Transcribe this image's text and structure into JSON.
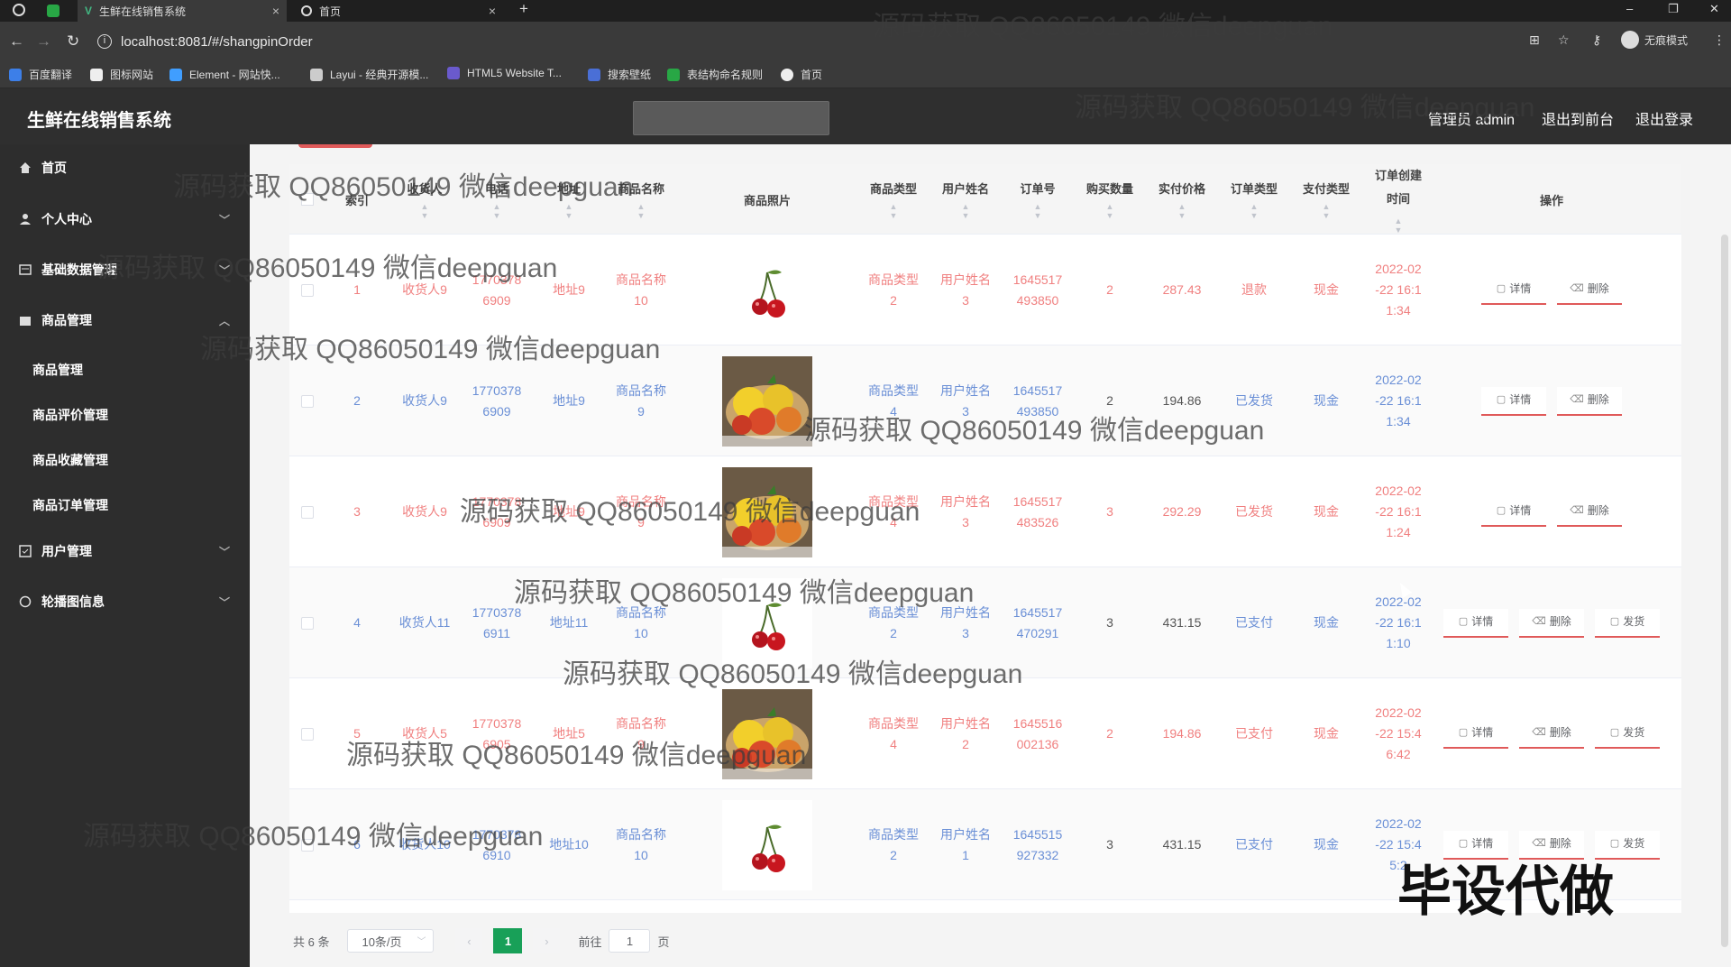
{
  "browser": {
    "tabs": [
      {
        "label": "生鲜在线销售系统",
        "active": true
      },
      {
        "label": "首页",
        "active": false
      }
    ],
    "new_tab": "+",
    "url": "localhost:8081/#/shangpinOrder",
    "profile": "无痕模式",
    "bookmarks": [
      "百度翻译",
      "图标网站",
      "Element - 网站快...",
      "Layui - 经典开源模...",
      "HTML5 Website T...",
      "搜索壁纸",
      "表结构命名规则",
      "首页"
    ]
  },
  "header": {
    "title": "生鲜在线销售系统",
    "admin": "管理员 admin",
    "front": "退出到前台",
    "logout": "退出登录"
  },
  "sidebar": {
    "items": [
      {
        "label": "首页",
        "icon": "home-icon"
      },
      {
        "label": "个人中心",
        "icon": "user-icon"
      },
      {
        "label": "基础数据管理",
        "icon": "data-icon"
      },
      {
        "label": "商品管理",
        "icon": "goods-icon"
      },
      {
        "label": "用户管理",
        "icon": "users-icon"
      },
      {
        "label": "轮播图信息",
        "icon": "carousel-icon"
      }
    ],
    "sub": [
      "商品管理",
      "商品评价管理",
      "商品收藏管理",
      "商品订单管理"
    ]
  },
  "table": {
    "headers": [
      "索引",
      "收货人",
      "电话",
      "地址",
      "商品名称",
      "商品照片",
      "商品类型",
      "用户姓名",
      "订单号",
      "购买数量",
      "实付价格",
      "订单类型",
      "支付类型",
      "订单创建时间",
      "操作"
    ],
    "rows": [
      {
        "idx": "1",
        "receiver": "收货人9",
        "phone": [
          "1770378",
          "6909"
        ],
        "addr": "地址9",
        "name": [
          "商品名称",
          "10"
        ],
        "photo": "cherry",
        "type": [
          "商品类型",
          "2"
        ],
        "user": [
          "用户姓名",
          "3"
        ],
        "order": [
          "1645517",
          "493850"
        ],
        "qty": "2",
        "price": "287.43",
        "otype": "退款",
        "pay": "现金",
        "time": [
          "2022-02",
          "-22 16:1",
          "1:34"
        ],
        "ops": [
          "详情",
          "删除"
        ],
        "color": "red"
      },
      {
        "idx": "2",
        "receiver": "收货人9",
        "phone": [
          "1770378",
          "6909"
        ],
        "addr": "地址9",
        "name": [
          "商品名称",
          "9"
        ],
        "photo": "fruit",
        "type": [
          "商品类型",
          "4"
        ],
        "user": [
          "用户姓名",
          "3"
        ],
        "order": [
          "1645517",
          "493850"
        ],
        "qty": "2",
        "price": "194.86",
        "otype": "已发货",
        "pay": "现金",
        "time": [
          "2022-02",
          "-22 16:1",
          "1:34"
        ],
        "ops": [
          "详情",
          "删除"
        ],
        "color": "blue"
      },
      {
        "idx": "3",
        "receiver": "收货人9",
        "phone": [
          "1770378",
          "6909"
        ],
        "addr": "地址9",
        "name": [
          "商品名称",
          "9"
        ],
        "photo": "fruit",
        "type": [
          "商品类型",
          "4"
        ],
        "user": [
          "用户姓名",
          "3"
        ],
        "order": [
          "1645517",
          "483526"
        ],
        "qty": "3",
        "price": "292.29",
        "otype": "已发货",
        "pay": "现金",
        "time": [
          "2022-02",
          "-22 16:1",
          "1:24"
        ],
        "ops": [
          "详情",
          "删除"
        ],
        "color": "red"
      },
      {
        "idx": "4",
        "receiver": "收货人11",
        "phone": [
          "1770378",
          "6911"
        ],
        "addr": "地址11",
        "name": [
          "商品名称",
          "10"
        ],
        "photo": "cherry",
        "type": [
          "商品类型",
          "2"
        ],
        "user": [
          "用户姓名",
          "3"
        ],
        "order": [
          "1645517",
          "470291"
        ],
        "qty": "3",
        "price": "431.15",
        "otype": "已支付",
        "pay": "现金",
        "time": [
          "2022-02",
          "-22 16:1",
          "1:10"
        ],
        "ops": [
          "详情",
          "删除",
          "发货"
        ],
        "color": "blue"
      },
      {
        "idx": "5",
        "receiver": "收货人5",
        "phone": [
          "1770378",
          "6905"
        ],
        "addr": "地址5",
        "name": [
          "商品名称",
          "9"
        ],
        "photo": "fruit",
        "type": [
          "商品类型",
          "4"
        ],
        "user": [
          "用户姓名",
          "2"
        ],
        "order": [
          "1645516",
          "002136"
        ],
        "qty": "2",
        "price": "194.86",
        "otype": "已支付",
        "pay": "现金",
        "time": [
          "2022-02",
          "-22 15:4",
          "6:42"
        ],
        "ops": [
          "详情",
          "删除",
          "发货"
        ],
        "color": "red"
      },
      {
        "idx": "6",
        "receiver": "收货人10",
        "phone": [
          "1770378",
          "6910"
        ],
        "addr": "地址10",
        "name": [
          "商品名称",
          "10"
        ],
        "photo": "cherry",
        "type": [
          "商品类型",
          "2"
        ],
        "user": [
          "用户姓名",
          "1"
        ],
        "order": [
          "1645515",
          "927332"
        ],
        "qty": "3",
        "price": "431.15",
        "otype": "已支付",
        "pay": "现金",
        "time": [
          "2022-02",
          "-22 15:4",
          "5:2"
        ],
        "ops": [
          "详情",
          "删除",
          "发货"
        ],
        "color": "blue"
      }
    ]
  },
  "pager": {
    "total": "共 6 条",
    "size": "10条/页",
    "page": "1",
    "goto_label": "前往",
    "goto_value": "1",
    "page_unit": "页"
  },
  "watermarks": {
    "text": "源码获取 QQ86050149 微信deepguan",
    "big": "毕设代做"
  }
}
